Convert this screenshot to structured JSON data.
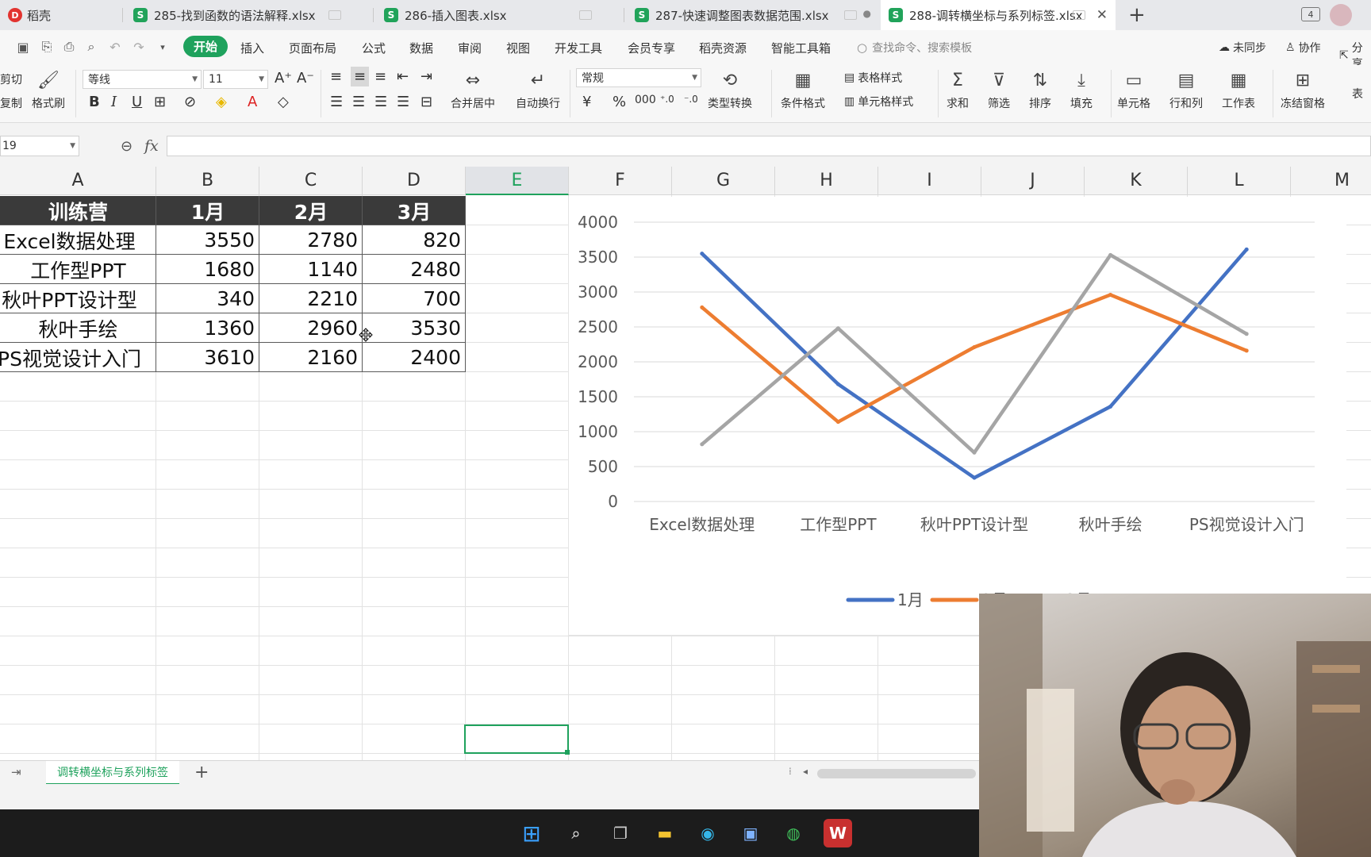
{
  "tabs": [
    {
      "label": "稻壳",
      "kind": "app"
    },
    {
      "label": "285-找到函数的语法解释.xlsx",
      "kind": "sheet"
    },
    {
      "label": "286-插入图表.xlsx",
      "kind": "sheet"
    },
    {
      "label": "287-快速调整图表数据范围.xlsx",
      "kind": "sheet"
    },
    {
      "label": "288-调转横坐标与系列标签.xlsx",
      "kind": "sheet",
      "active": true
    }
  ],
  "window_count": "4",
  "menu": {
    "items": [
      "开始",
      "插入",
      "页面布局",
      "公式",
      "数据",
      "审阅",
      "视图",
      "开发工具",
      "会员专享",
      "稻壳资源",
      "智能工具箱"
    ],
    "active_index": 0,
    "search_placeholder": "查找命令、搜索模板",
    "sync_label": "未同步",
    "collab_label": "协作",
    "share_label": "分享"
  },
  "ribbon": {
    "cut_label": "剪切",
    "copy_label": "复制",
    "format_painter_label": "格式刷",
    "font_name": "等线",
    "font_size": "11",
    "merge_label": "合并居中",
    "wrap_label": "自动换行",
    "number_format": "常规",
    "type_convert_label": "类型转换",
    "cond_format_label": "条件格式",
    "table_style_label": "表格样式",
    "cell_style_label": "单元格样式",
    "sum_label": "求和",
    "filter_label": "筛选",
    "sort_label": "排序",
    "fill_label": "填充",
    "cells_label": "单元格",
    "rowcol_label": "行和列",
    "worksheet_label": "工作表",
    "freeze_label": "冻结窗格",
    "table_label": "表"
  },
  "formula_bar": {
    "name_box": "19",
    "fx": "fx",
    "value": ""
  },
  "columns": [
    "A",
    "B",
    "C",
    "D",
    "E",
    "F",
    "G",
    "H",
    "I",
    "J",
    "K",
    "L",
    "M"
  ],
  "selected_column": "E",
  "table": {
    "header": [
      "训练营",
      "1月",
      "2月",
      "3月"
    ],
    "rows": [
      [
        "Excel数据处理",
        "3550",
        "2780",
        "820"
      ],
      [
        "工作型PPT",
        "1680",
        "1140",
        "2480"
      ],
      [
        "秋叶PPT设计型",
        "340",
        "2210",
        "700"
      ],
      [
        "秋叶手绘",
        "1360",
        "2960",
        "3530"
      ],
      [
        "PS视觉设计入门",
        "3610",
        "2160",
        "2400"
      ]
    ]
  },
  "chart_data": {
    "type": "line",
    "categories": [
      "Excel数据处理",
      "工作型PPT",
      "秋叶PPT设计型",
      "秋叶手绘",
      "PS视觉设计入门"
    ],
    "series": [
      {
        "name": "1月",
        "values": [
          3550,
          1680,
          340,
          1360,
          3610
        ],
        "color": "#4472c4"
      },
      {
        "name": "2月",
        "values": [
          2780,
          1140,
          2210,
          2960,
          2160
        ],
        "color": "#ed7d31"
      },
      {
        "name": "3月",
        "values": [
          820,
          2480,
          700,
          3530,
          2400
        ],
        "color": "#a5a5a5"
      }
    ],
    "ylim": [
      0,
      4000
    ],
    "yticks": [
      0,
      500,
      1000,
      1500,
      2000,
      2500,
      3000,
      3500,
      4000
    ],
    "grid": true,
    "legend": "bottom"
  },
  "sheet_tab": "调转横坐标与系列标签"
}
